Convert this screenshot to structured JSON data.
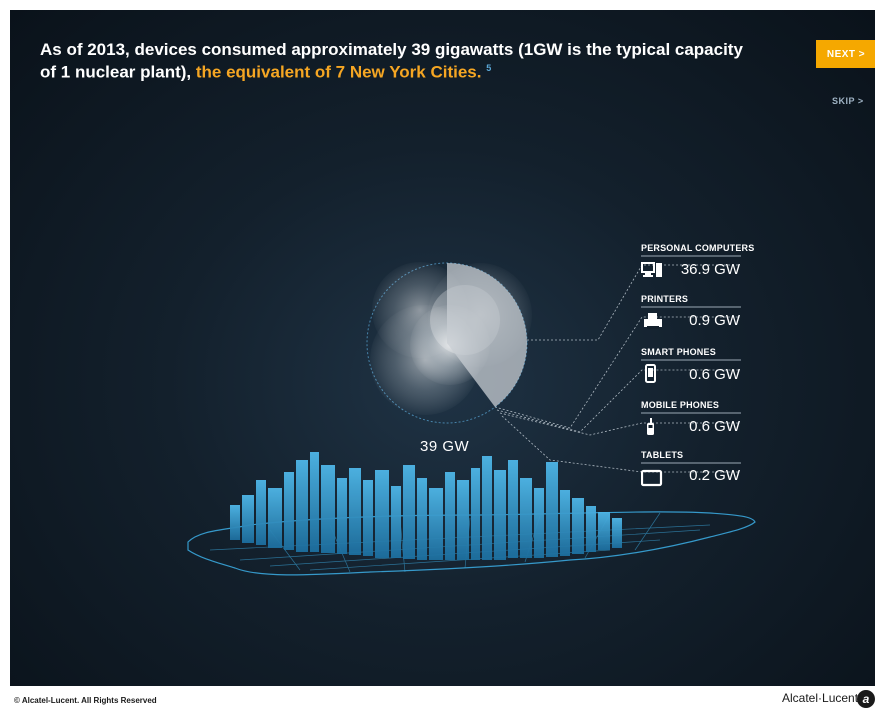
{
  "headline": {
    "main": "As of 2013, devices consumed approximately 39 gigawatts (1GW is the typical capacity of 1 nuclear plant), ",
    "highlight": "the equivalent of 7 New York Cities.",
    "footnote": "5"
  },
  "nav": {
    "next_label": "NEXT >",
    "skip_label": "SKIP >"
  },
  "total_label": "39 GW",
  "categories": [
    {
      "label": "PERSONAL COMPUTERS",
      "value": "36.9 GW",
      "icon": "desktop-computer-icon"
    },
    {
      "label": "PRINTERS",
      "value": "0.9 GW",
      "icon": "printer-icon"
    },
    {
      "label": "SMART PHONES",
      "value": "0.6 GW",
      "icon": "smartphone-icon"
    },
    {
      "label": "MOBILE PHONES",
      "value": "0.6 GW",
      "icon": "mobile-phone-icon"
    },
    {
      "label": "TABLETS",
      "value": "0.2 GW",
      "icon": "tablet-icon"
    }
  ],
  "footer": {
    "copyright": "© Alcatel-Lucent. All Rights Reserved",
    "brand": "Alcatel·Lucent"
  },
  "colors": {
    "accent": "#f5a800",
    "highlight": "#f5a623",
    "city": "#3aa6dc",
    "background": "#13202c"
  }
}
